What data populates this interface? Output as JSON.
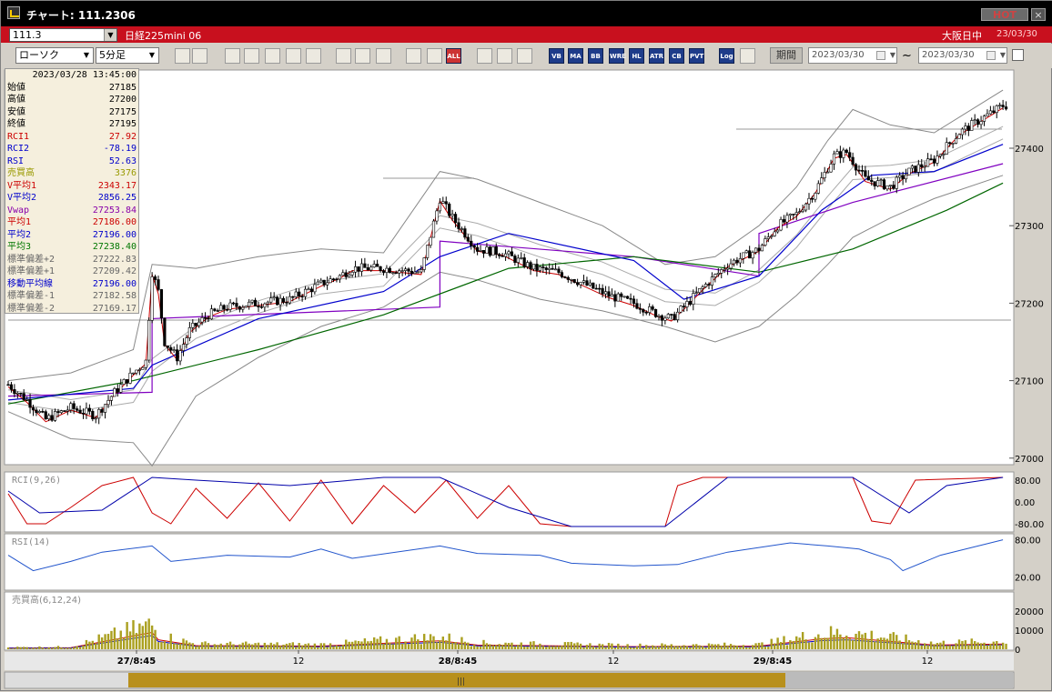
{
  "window": {
    "title": "チャート: 111.2306",
    "hot_label": "HOT",
    "close_label": "×"
  },
  "infobar": {
    "code": "111.3",
    "name": "日経225mini 06",
    "market": "大阪日中",
    "date": "23/03/30"
  },
  "toolbar": {
    "chart_type": "ローソク",
    "interval": "5分足",
    "period_label": "期間",
    "date_from": "2023/03/30",
    "date_to": "2023/03/30",
    "tilde": "~",
    "buttons": [
      {
        "name": "zoom-icon",
        "text": ""
      },
      {
        "name": "bar-width-icon",
        "text": ""
      },
      {
        "name": "tool1-icon",
        "text": ""
      },
      {
        "name": "tool2-icon",
        "text": ""
      },
      {
        "name": "tool3-icon",
        "text": ""
      },
      {
        "name": "tool4-icon",
        "text": ""
      },
      {
        "name": "tool5-icon",
        "text": ""
      },
      {
        "name": "pen-icon",
        "text": ""
      },
      {
        "name": "cursor-icon",
        "text": ""
      },
      {
        "name": "undo-icon",
        "text": ""
      },
      {
        "name": "candle-a-icon",
        "text": ""
      },
      {
        "name": "candle-b-icon",
        "text": ""
      },
      {
        "name": "delete-all-button",
        "text": "ALL"
      },
      {
        "name": "settings-icon",
        "text": ""
      },
      {
        "name": "brush-icon",
        "text": ""
      },
      {
        "name": "color-icon",
        "text": ""
      },
      {
        "name": "vb-button",
        "text": "VB"
      },
      {
        "name": "ma-button",
        "text": "MA"
      },
      {
        "name": "bb-button",
        "text": "BB"
      },
      {
        "name": "wre-button",
        "text": "WRE"
      },
      {
        "name": "hl-button",
        "text": "HL"
      },
      {
        "name": "atr-button",
        "text": "ATR"
      },
      {
        "name": "cb-button",
        "text": "CB"
      },
      {
        "name": "pvt-button",
        "text": "PVT"
      },
      {
        "name": "log-button",
        "text": "Log"
      },
      {
        "name": "export-icon",
        "text": ""
      }
    ]
  },
  "values_panel": {
    "datetime": "2023/03/28  13:45:00",
    "rows": [
      {
        "label": "始値",
        "value": "27185",
        "color": "#000000"
      },
      {
        "label": "高値",
        "value": "27200",
        "color": "#000000"
      },
      {
        "label": "安値",
        "value": "27175",
        "color": "#000000"
      },
      {
        "label": "終値",
        "value": "27195",
        "color": "#000000"
      },
      {
        "label": "RCI1",
        "value": "27.92",
        "color": "#cc0000"
      },
      {
        "label": "RCI2",
        "value": "-78.19",
        "color": "#0000cc"
      },
      {
        "label": "RSI",
        "value": "52.63",
        "color": "#0000cc"
      },
      {
        "label": "売買高",
        "value": "3376",
        "color": "#999900"
      },
      {
        "label": "V平均1",
        "value": "2343.17",
        "color": "#cc0000"
      },
      {
        "label": "V平均2",
        "value": "2856.25",
        "color": "#0000cc"
      },
      {
        "label": "Vwap",
        "value": "27253.84",
        "color": "#8800aa"
      },
      {
        "label": "平均1",
        "value": "27186.00",
        "color": "#cc0000"
      },
      {
        "label": "平均2",
        "value": "27196.00",
        "color": "#0000cc"
      },
      {
        "label": "平均3",
        "value": "27238.40",
        "color": "#007700"
      },
      {
        "label": "標準偏差+2",
        "value": "27222.83",
        "color": "#666666"
      },
      {
        "label": "標準偏差+1",
        "value": "27209.42",
        "color": "#666666"
      },
      {
        "label": "移動平均線",
        "value": "27196.00",
        "color": "#0000cc"
      },
      {
        "label": "標準偏差-1",
        "value": "27182.58",
        "color": "#666666"
      },
      {
        "label": "標準偏差-2",
        "value": "27169.17",
        "color": "#666666"
      }
    ]
  },
  "panels": {
    "rci_label": "RCI(9,26)",
    "rci_ticks": [
      "80.00",
      "0.00",
      "-80.00"
    ],
    "rsi_label": "RSI(14)",
    "rsi_ticks": [
      "80.00",
      "20.00"
    ],
    "vol_label": "売買高(6,12,24)",
    "vol_ticks": [
      "20000",
      "10000",
      "0"
    ]
  },
  "chart_data": {
    "type": "candlestick",
    "price_axis_ticks": [
      27400,
      27300,
      27200,
      27100,
      27000
    ],
    "x_tick_labels": [
      "27/8:45",
      "12",
      "28/8:45",
      "12",
      "29/8:45",
      "12"
    ],
    "price_close_path": [
      [
        0,
        27095
      ],
      [
        6,
        27075
      ],
      [
        12,
        27050
      ],
      [
        20,
        27065
      ],
      [
        28,
        27055
      ],
      [
        34,
        27085
      ],
      [
        40,
        27110
      ],
      [
        44,
        27125
      ],
      [
        46,
        27240
      ],
      [
        48,
        27215
      ],
      [
        50,
        27150
      ],
      [
        54,
        27130
      ],
      [
        58,
        27165
      ],
      [
        64,
        27185
      ],
      [
        70,
        27195
      ],
      [
        80,
        27200
      ],
      [
        90,
        27205
      ],
      [
        100,
        27225
      ],
      [
        106,
        27235
      ],
      [
        110,
        27245
      ],
      [
        120,
        27245
      ],
      [
        132,
        27240
      ],
      [
        138,
        27335
      ],
      [
        142,
        27310
      ],
      [
        150,
        27270
      ],
      [
        158,
        27265
      ],
      [
        168,
        27245
      ],
      [
        176,
        27240
      ],
      [
        184,
        27225
      ],
      [
        192,
        27210
      ],
      [
        200,
        27200
      ],
      [
        208,
        27185
      ],
      [
        212,
        27180
      ],
      [
        216,
        27195
      ],
      [
        222,
        27220
      ],
      [
        230,
        27250
      ],
      [
        240,
        27270
      ],
      [
        246,
        27300
      ],
      [
        252,
        27315
      ],
      [
        258,
        27345
      ],
      [
        264,
        27390
      ],
      [
        268,
        27395
      ],
      [
        274,
        27360
      ],
      [
        282,
        27350
      ],
      [
        288,
        27370
      ],
      [
        296,
        27385
      ],
      [
        304,
        27420
      ],
      [
        312,
        27440
      ],
      [
        318,
        27455
      ]
    ],
    "upper_band_path": [
      [
        0,
        27100
      ],
      [
        20,
        27110
      ],
      [
        40,
        27140
      ],
      [
        46,
        27250
      ],
      [
        60,
        27245
      ],
      [
        80,
        27260
      ],
      [
        100,
        27270
      ],
      [
        120,
        27265
      ],
      [
        138,
        27370
      ],
      [
        150,
        27360
      ],
      [
        170,
        27330
      ],
      [
        190,
        27300
      ],
      [
        210,
        27250
      ],
      [
        226,
        27260
      ],
      [
        240,
        27300
      ],
      [
        252,
        27350
      ],
      [
        262,
        27410
      ],
      [
        270,
        27450
      ],
      [
        282,
        27430
      ],
      [
        296,
        27420
      ],
      [
        318,
        27475
      ]
    ],
    "lower_band_path": [
      [
        0,
        27060
      ],
      [
        20,
        27025
      ],
      [
        40,
        27020
      ],
      [
        46,
        26990
      ],
      [
        60,
        27080
      ],
      [
        80,
        27130
      ],
      [
        100,
        27170
      ],
      [
        120,
        27195
      ],
      [
        138,
        27240
      ],
      [
        150,
        27230
      ],
      [
        170,
        27205
      ],
      [
        190,
        27190
      ],
      [
        210,
        27170
      ],
      [
        226,
        27150
      ],
      [
        240,
        27170
      ],
      [
        252,
        27210
      ],
      [
        262,
        27250
      ],
      [
        270,
        27285
      ],
      [
        282,
        27310
      ],
      [
        296,
        27335
      ],
      [
        318,
        27365
      ]
    ],
    "vwap_path": [
      [
        0,
        27080
      ],
      [
        46,
        27085
      ],
      [
        46,
        27180
      ],
      [
        138,
        27195
      ],
      [
        138,
        27280
      ],
      [
        200,
        27260
      ],
      [
        240,
        27235
      ],
      [
        240,
        27290
      ],
      [
        270,
        27330
      ],
      [
        318,
        27380
      ]
    ],
    "ma_long_path": [
      [
        0,
        27070
      ],
      [
        40,
        27100
      ],
      [
        80,
        27140
      ],
      [
        120,
        27185
      ],
      [
        160,
        27245
      ],
      [
        200,
        27260
      ],
      [
        240,
        27240
      ],
      [
        270,
        27270
      ],
      [
        300,
        27320
      ],
      [
        318,
        27355
      ]
    ],
    "ma_mid_path": [
      [
        0,
        27075
      ],
      [
        40,
        27090
      ],
      [
        46,
        27120
      ],
      [
        80,
        27180
      ],
      [
        120,
        27215
      ],
      [
        138,
        27260
      ],
      [
        160,
        27290
      ],
      [
        200,
        27255
      ],
      [
        216,
        27205
      ],
      [
        240,
        27235
      ],
      [
        260,
        27320
      ],
      [
        276,
        27365
      ],
      [
        296,
        27370
      ],
      [
        318,
        27405
      ]
    ],
    "rci_short": [
      [
        0,
        30
      ],
      [
        6,
        -80
      ],
      [
        12,
        -80
      ],
      [
        20,
        -20
      ],
      [
        30,
        60
      ],
      [
        40,
        90
      ],
      [
        46,
        -40
      ],
      [
        52,
        -80
      ],
      [
        60,
        50
      ],
      [
        70,
        -60
      ],
      [
        80,
        70
      ],
      [
        90,
        -70
      ],
      [
        100,
        80
      ],
      [
        110,
        -80
      ],
      [
        120,
        60
      ],
      [
        130,
        -40
      ],
      [
        140,
        80
      ],
      [
        150,
        -60
      ],
      [
        160,
        60
      ],
      [
        170,
        -80
      ],
      [
        180,
        -90
      ],
      [
        210,
        -90
      ],
      [
        214,
        60
      ],
      [
        222,
        90
      ],
      [
        270,
        90
      ],
      [
        276,
        -70
      ],
      [
        282,
        -80
      ],
      [
        290,
        80
      ],
      [
        318,
        90
      ]
    ],
    "rci_long": [
      [
        0,
        40
      ],
      [
        10,
        -40
      ],
      [
        30,
        -30
      ],
      [
        46,
        90
      ],
      [
        60,
        80
      ],
      [
        90,
        60
      ],
      [
        120,
        90
      ],
      [
        138,
        90
      ],
      [
        160,
        -20
      ],
      [
        180,
        -90
      ],
      [
        210,
        -90
      ],
      [
        230,
        90
      ],
      [
        270,
        90
      ],
      [
        288,
        -40
      ],
      [
        300,
        60
      ],
      [
        318,
        90
      ]
    ],
    "rsi": [
      [
        0,
        55
      ],
      [
        8,
        30
      ],
      [
        20,
        45
      ],
      [
        30,
        60
      ],
      [
        46,
        70
      ],
      [
        52,
        45
      ],
      [
        70,
        55
      ],
      [
        90,
        52
      ],
      [
        100,
        65
      ],
      [
        110,
        50
      ],
      [
        138,
        70
      ],
      [
        150,
        58
      ],
      [
        170,
        55
      ],
      [
        180,
        42
      ],
      [
        200,
        38
      ],
      [
        214,
        40
      ],
      [
        230,
        60
      ],
      [
        250,
        75
      ],
      [
        262,
        70
      ],
      [
        272,
        65
      ],
      [
        282,
        48
      ],
      [
        286,
        30
      ],
      [
        298,
        55
      ],
      [
        318,
        80
      ]
    ],
    "volume_peaks": [
      [
        0,
        1200
      ],
      [
        20,
        1500
      ],
      [
        46,
        16000
      ],
      [
        48,
        9000
      ],
      [
        60,
        3500
      ],
      [
        100,
        3000
      ],
      [
        138,
        8000
      ],
      [
        150,
        4000
      ],
      [
        200,
        2500
      ],
      [
        240,
        3000
      ],
      [
        260,
        10000
      ],
      [
        268,
        11000
      ],
      [
        276,
        9000
      ],
      [
        296,
        4000
      ],
      [
        318,
        5000
      ]
    ]
  }
}
